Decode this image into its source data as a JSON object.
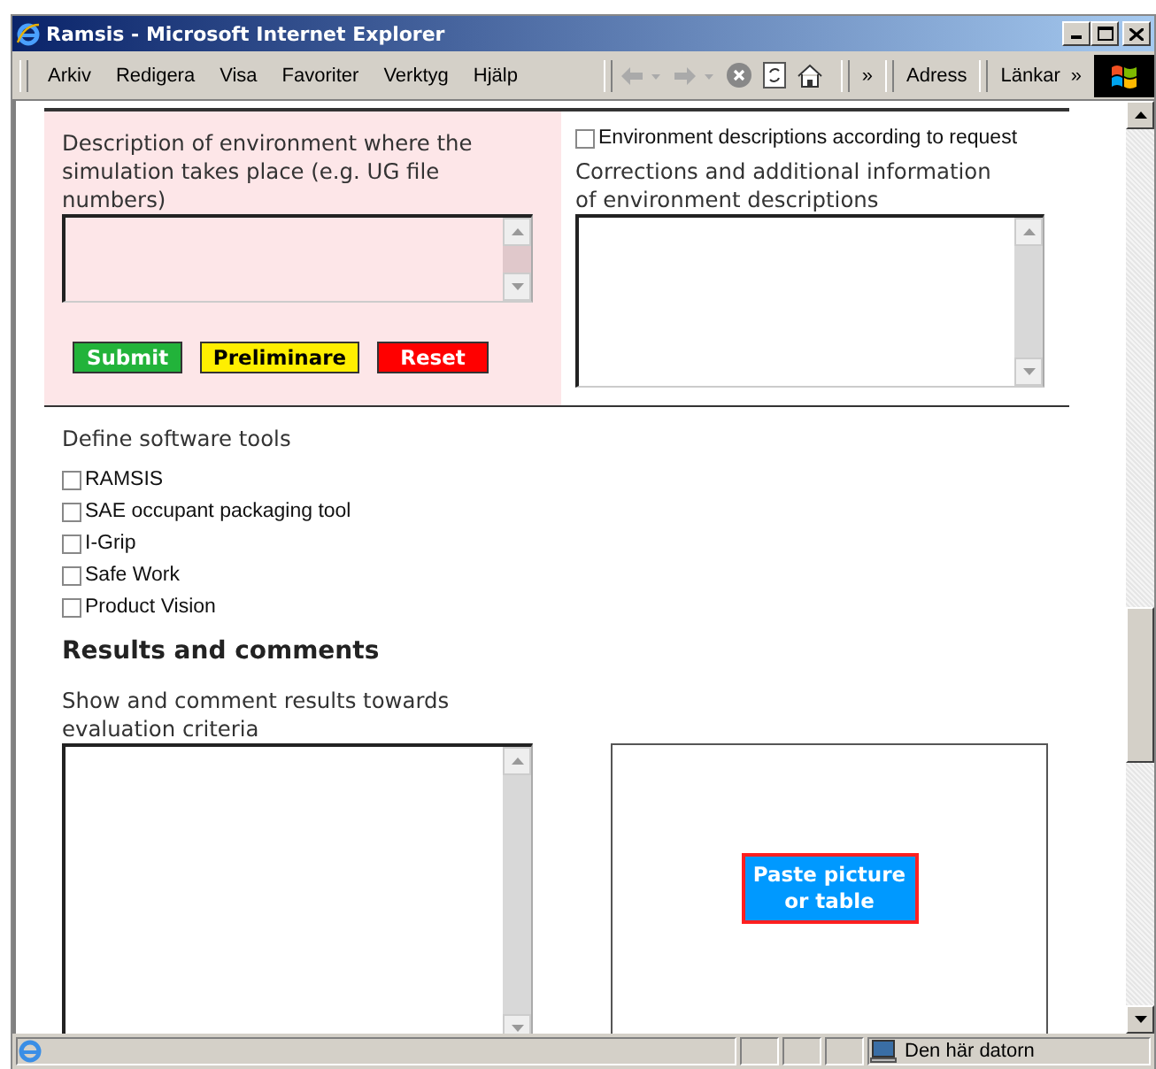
{
  "window": {
    "title": "Ramsis - Microsoft Internet Explorer"
  },
  "menu": [
    "Arkiv",
    "Redigera",
    "Visa",
    "Favoriter",
    "Verktyg",
    "Hjälp"
  ],
  "toolbar": {
    "overflow": "»",
    "address_label": "Adress",
    "links_label": "Länkar",
    "links_overflow": "»"
  },
  "environment": {
    "description_label": "Description of environment where the simulation takes place (e.g. UG file numbers)",
    "buttons": [
      {
        "label": "Submit",
        "kind": "submit"
      },
      {
        "label": "Preliminare",
        "kind": "preliminary"
      },
      {
        "label": "Reset",
        "kind": "reset"
      }
    ],
    "request_checkbox": {
      "label": "Environment descriptions according to request",
      "checked": false
    },
    "corrections_label": "Corrections and additional information of environment descriptions"
  },
  "software_tools": {
    "label": "Define software tools",
    "items": [
      {
        "label": "RAMSIS",
        "checked": false
      },
      {
        "label": "SAE occupant packaging tool",
        "checked": false
      },
      {
        "label": "I-Grip",
        "checked": false
      },
      {
        "label": "Safe Work",
        "checked": false
      },
      {
        "label": "Product Vision",
        "checked": false
      }
    ]
  },
  "results": {
    "heading": "Results and comments",
    "label": "Show and comment results towards evaluation criteria",
    "paste_button": "Paste picture or table"
  },
  "status_bar": {
    "zone": "Den här datorn"
  }
}
